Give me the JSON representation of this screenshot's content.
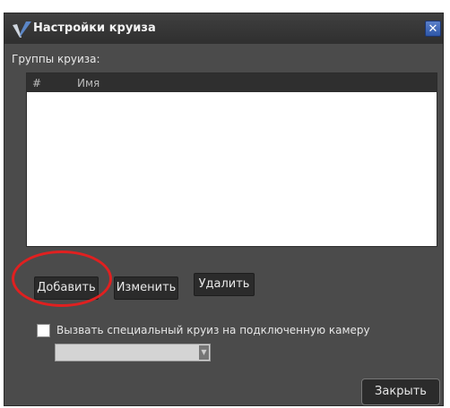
{
  "window": {
    "title": "Настройки круиза",
    "close_glyph": "✕"
  },
  "groups": {
    "label": "Группы круиза:",
    "columns": [
      "#",
      "Имя"
    ],
    "rows": []
  },
  "buttons": {
    "add": "Добавить",
    "edit": "Изменить",
    "delete": "Удалить",
    "close": "Закрыть"
  },
  "special_cruise": {
    "label": "Вызвать специальный круиз на подключенную камеру",
    "checked": false,
    "selected_value": ""
  },
  "colors": {
    "window_bg": "#4b4b4b",
    "highlight": "#e02020",
    "close_btn": "#2e57a8"
  }
}
